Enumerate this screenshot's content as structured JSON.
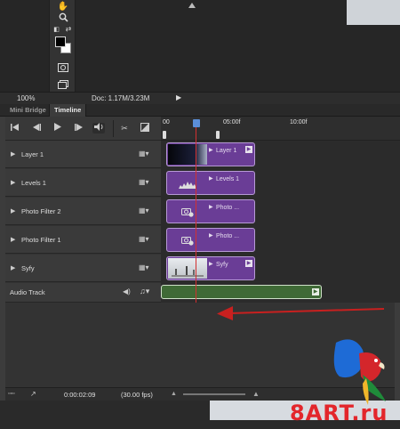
{
  "status_bar": {
    "zoom": "100%",
    "doc": "Doc: 1.17M/3.23M"
  },
  "tabs": [
    {
      "label": "Mini Bridge"
    },
    {
      "label": "Timeline"
    }
  ],
  "ruler": {
    "ticks": [
      "00",
      "05:00f",
      "10:00f"
    ]
  },
  "layers": [
    {
      "label": "Layer 1"
    },
    {
      "label": "Levels 1"
    },
    {
      "label": "Photo Filter 2"
    },
    {
      "label": "Photo Filter 1"
    },
    {
      "label": "Syfy"
    }
  ],
  "audio_track": {
    "label": "Audio Track"
  },
  "clips": [
    {
      "label": "Layer 1"
    },
    {
      "label": "Levels 1"
    },
    {
      "label": "Photo ..."
    },
    {
      "label": "Photo ..."
    },
    {
      "label": "Syfy"
    }
  ],
  "bottom_bar": {
    "timecode": "0:00:02:09",
    "fps": "(30.00 fps)"
  },
  "watermark": {
    "brand": "8ART.ru"
  },
  "colors": {
    "clip": "#6a3d96",
    "audio_clip": "#3f6a36",
    "playhead": "#d23030",
    "arrow": "#c8201f"
  }
}
